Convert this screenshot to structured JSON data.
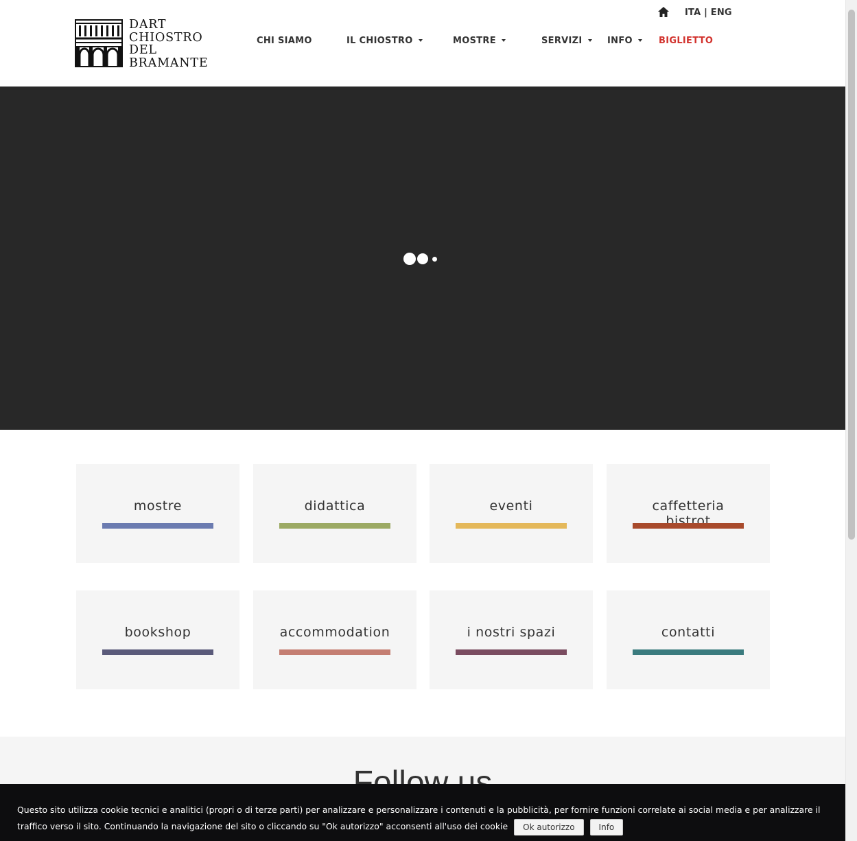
{
  "header": {
    "logo_lines": [
      "DART",
      "CHIOSTRO",
      "DEL",
      "BRAMANTE"
    ],
    "nav": [
      {
        "label": "CHI SIAMO",
        "dropdown": false
      },
      {
        "label": "IL CHIOSTRO",
        "dropdown": true
      },
      {
        "label": "MOSTRE",
        "dropdown": true
      },
      {
        "label": "SERVIZI",
        "dropdown": true
      },
      {
        "label": "INFO",
        "dropdown": true
      },
      {
        "label": "BIGLIETTO",
        "dropdown": false,
        "color": "#d2322d"
      }
    ],
    "lang_ita": "ITA",
    "lang_sep": " | ",
    "lang_eng": "ENG",
    "home_icon": "home-icon"
  },
  "hero": {
    "background": "#282828",
    "loader_icon": "loading-dots-icon"
  },
  "tiles": [
    {
      "label": "mostre",
      "color": "#6b7bb0"
    },
    {
      "label": "didattica",
      "color": "#9caa64"
    },
    {
      "label": "eventi",
      "color": "#e4b85a"
    },
    {
      "label": "caffetteria bistrot",
      "color": "#a84a2c"
    },
    {
      "label": "bookshop",
      "color": "#5a5a7a"
    },
    {
      "label": "accommodation",
      "color": "#c47e72"
    },
    {
      "label": "i nostri spazi",
      "color": "#7a4c60"
    },
    {
      "label": "contatti",
      "color": "#3a7b7e"
    }
  ],
  "follow": {
    "title": "Follow us"
  },
  "cookie": {
    "text": "Questo sito utilizza cookie tecnici e analitici (propri o di terze parti) per analizzare e personalizzare i contenuti e la pubblicità, per fornire funzioni correlate ai social media e per analizzare il traffico verso il sito. Continuando la navigazione del sito o cliccando su \"Ok autorizzo\" acconsenti all'uso dei cookie",
    "accept_label": "Ok autorizzo",
    "info_label": "Info"
  }
}
